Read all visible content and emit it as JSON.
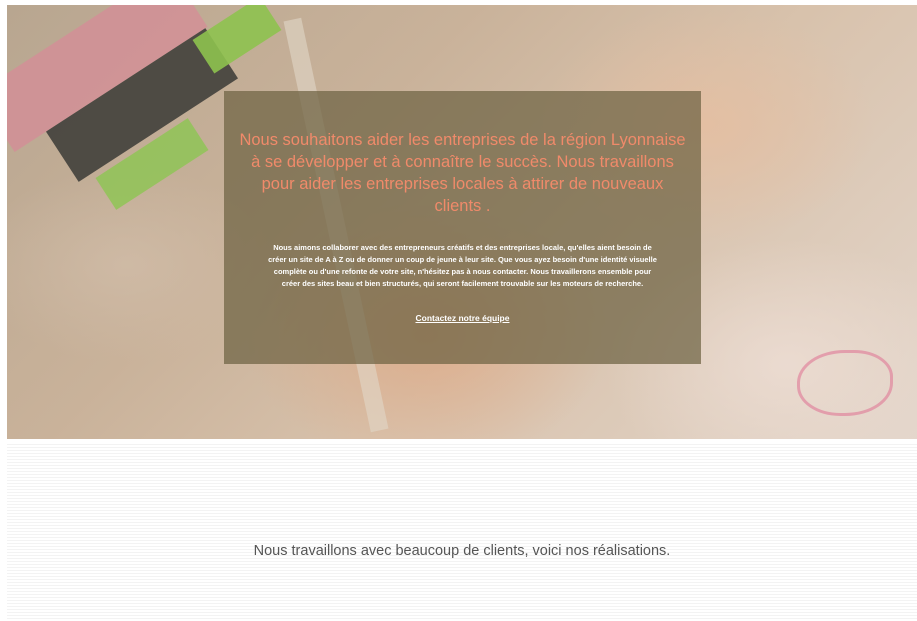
{
  "hero": {
    "heading": "Nous souhaitons aider les entreprises de la région Lyonnaise à se développer et à connaître le succès. Nous travaillons pour aider les entreprises locales à attirer de nouveaux clients .",
    "paragraph": "Nous aimons collaborer avec des entrepreneurs créatifs et des entreprises locale, qu'elles aient besoin de créer un site de A à Z ou de donner un coup de jeune à leur site. Que vous ayez besoin d'une identité visuelle complète ou d'une refonte de votre site, n'hésitez pas à nous contacter. Nous travaillerons ensemble pour créer des sites beau et bien structurés, qui seront facilement trouvable sur les moteurs de recherche.",
    "link_label": "Contactez notre équipe"
  },
  "portfolio": {
    "text": "Nous travaillons avec beaucoup de clients, voici nos réalisations."
  },
  "colors": {
    "heading": "#f08a6a",
    "overlay": "#6e6242",
    "body_text": "#555555"
  }
}
